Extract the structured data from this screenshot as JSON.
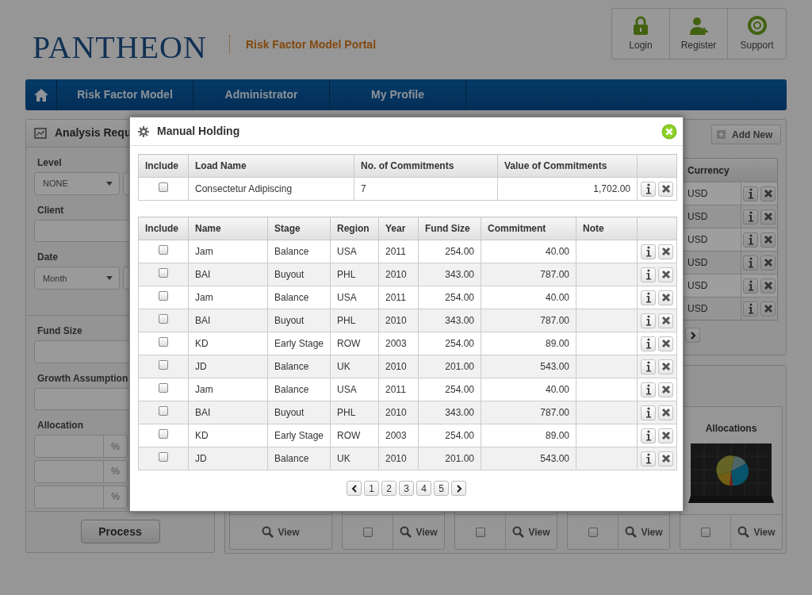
{
  "header": {
    "logo": "PANTHEON",
    "subtitle": "Risk Factor Model Portal",
    "actions": [
      {
        "label": "Login",
        "kind": "lock"
      },
      {
        "label": "Register",
        "kind": "user-add"
      },
      {
        "label": "Support",
        "kind": "lifebuoy"
      }
    ]
  },
  "nav": {
    "items": [
      "Risk Factor Model",
      "Administrator",
      "My Profile"
    ]
  },
  "analysis_panel": {
    "title": "Analysis Requ",
    "fields": [
      {
        "label": "Level",
        "kind": "select",
        "value": "NONE"
      },
      {
        "label": "Client",
        "kind": "text"
      },
      {
        "label": "Date",
        "kind": "select",
        "value": "Month"
      }
    ],
    "fields_lower": [
      {
        "label": "Fund Size",
        "kind": "text"
      },
      {
        "label": "Growth Assumption",
        "kind": "text"
      },
      {
        "label": "Allocation",
        "kind": "percent",
        "units": [
          "%",
          "%",
          "%"
        ]
      }
    ],
    "process_button": "Process"
  },
  "holdings_panel": {
    "add_button": "Add New",
    "column": "Currency",
    "rows": [
      "USD",
      "USD",
      "USD",
      "USD",
      "USD",
      "USD"
    ]
  },
  "views_panel": {
    "cards": [
      {
        "kind": "view-only",
        "view": "View"
      },
      {
        "kind": "select-view",
        "checked": false,
        "view": "View"
      },
      {
        "kind": "select-view",
        "checked": false,
        "view": "View"
      },
      {
        "kind": "select-view",
        "checked": false,
        "view": "View"
      },
      {
        "kind": "select-view",
        "checked": false,
        "view": "View",
        "title": "Allocations"
      }
    ]
  },
  "modal": {
    "title": "Manual Holding",
    "summary": {
      "columns": [
        "Include",
        "Load Name",
        "No. of Commitments",
        "Value of Commitments"
      ],
      "rows": [
        {
          "checked": false,
          "load_name": "Consectetur Adipiscing",
          "count": "7",
          "value": "1,702.00"
        }
      ]
    },
    "holdings": {
      "columns": [
        "Include",
        "Name",
        "Stage",
        "Region",
        "Year",
        "Fund Size",
        "Commitment",
        "Note"
      ],
      "rows": [
        {
          "checked": false,
          "name": "Jam",
          "stage": "Balance",
          "region": "USA",
          "year": "2011",
          "fund_size": "254.00",
          "commitment": "40.00"
        },
        {
          "checked": false,
          "name": "BAI",
          "stage": "Buyout",
          "region": "PHL",
          "year": "2010",
          "fund_size": "343.00",
          "commitment": "787.00"
        },
        {
          "checked": false,
          "name": "Jam",
          "stage": "Balance",
          "region": "USA",
          "year": "2011",
          "fund_size": "254.00",
          "commitment": "40.00"
        },
        {
          "checked": false,
          "name": "BAI",
          "stage": "Buyout",
          "region": "PHL",
          "year": "2010",
          "fund_size": "343.00",
          "commitment": "787.00"
        },
        {
          "checked": false,
          "name": "KD",
          "stage": "Early Stage",
          "region": "ROW",
          "year": "2003",
          "fund_size": "254.00",
          "commitment": "89.00"
        },
        {
          "checked": false,
          "name": "JD",
          "stage": "Balance",
          "region": "UK",
          "year": "2010",
          "fund_size": "201.00",
          "commitment": "543.00"
        },
        {
          "checked": false,
          "name": "Jam",
          "stage": "Balance",
          "region": "USA",
          "year": "2011",
          "fund_size": "254.00",
          "commitment": "40.00"
        },
        {
          "checked": false,
          "name": "BAI",
          "stage": "Buyout",
          "region": "PHL",
          "year": "2010",
          "fund_size": "343.00",
          "commitment": "787.00"
        },
        {
          "checked": false,
          "name": "KD",
          "stage": "Early Stage",
          "region": "ROW",
          "year": "2003",
          "fund_size": "254.00",
          "commitment": "89.00"
        },
        {
          "checked": false,
          "name": "JD",
          "stage": "Balance",
          "region": "UK",
          "year": "2010",
          "fund_size": "201.00",
          "commitment": "543.00"
        }
      ]
    },
    "pagination": {
      "pages": [
        {
          "label": "1",
          "selected": false
        },
        {
          "label": "2",
          "selected": false
        },
        {
          "label": "3",
          "selected": false
        },
        {
          "label": "4",
          "selected": false
        },
        {
          "label": "5",
          "selected": false
        }
      ]
    }
  }
}
